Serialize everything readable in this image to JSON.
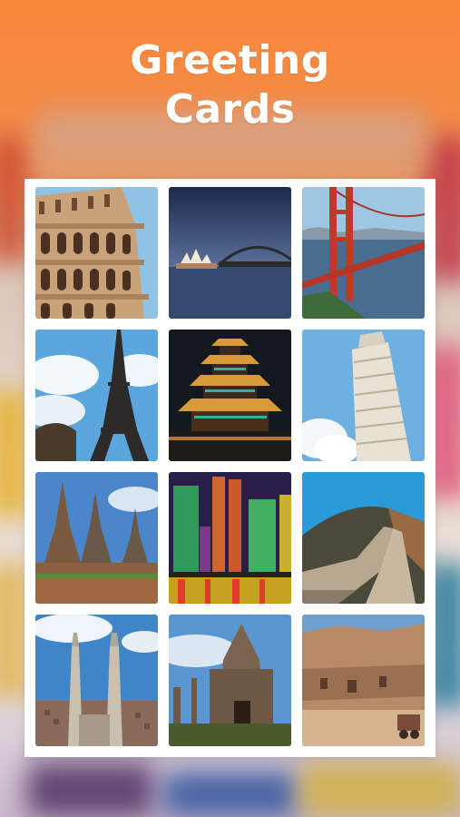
{
  "header": {
    "title_line1": "Greeting",
    "title_line2": "Cards"
  },
  "colors": {
    "accent": "#f7883a",
    "panel": "#ffffff"
  },
  "cards": [
    {
      "name": "card-colosseum"
    },
    {
      "name": "card-sydney-opera-house"
    },
    {
      "name": "card-golden-gate-bridge"
    },
    {
      "name": "card-eiffel-tower"
    },
    {
      "name": "card-pagoda-night"
    },
    {
      "name": "card-leaning-tower-pisa"
    },
    {
      "name": "card-thai-temple"
    },
    {
      "name": "card-city-skyline-night"
    },
    {
      "name": "card-great-wall"
    },
    {
      "name": "card-cathedral-towers"
    },
    {
      "name": "card-angkor-ruins"
    },
    {
      "name": "card-petra-cliffs"
    }
  ]
}
